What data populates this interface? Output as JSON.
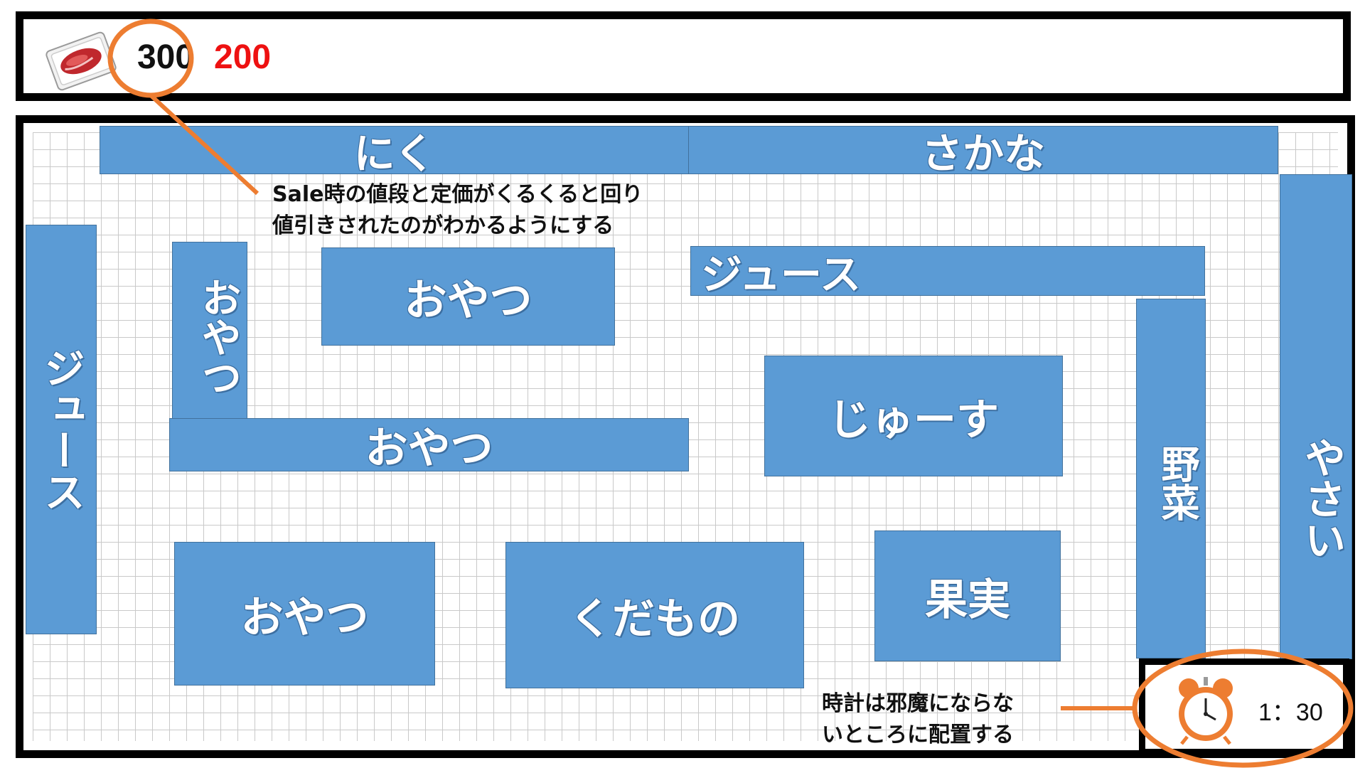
{
  "header": {
    "price_regular": "300",
    "price_sale": "200"
  },
  "shelves": {
    "niku": "にく",
    "sakana": "さかな",
    "juice_left": "ジュース",
    "oyatsu_vertical": "おやつ",
    "oyatsu_top": "おやつ",
    "juice_top_mid": "ジュース",
    "yasai_right": "やさい",
    "yasai_kanji": "野菜",
    "oyatsu_mid": "おやつ",
    "juusu_hira": "じゅーす",
    "oyatsu_bottom": "おやつ",
    "kudamono": "くだもの",
    "kajitsu": "果実"
  },
  "annotations": {
    "sale_line1": "Sale時の値段と定価がくるくると回り",
    "sale_line2": "値引きされたのがわかるようにする",
    "clock_line1": "時計は邪魔にならな",
    "clock_line2": "いところに配置する"
  },
  "clock": {
    "time": "1：30"
  },
  "colors": {
    "shelf": "#5b9bd5",
    "sale_price": "#ee1111",
    "callout": "#ed7d31"
  },
  "icons": {
    "meat": "meat-pack-icon",
    "clock": "alarm-clock-icon"
  }
}
